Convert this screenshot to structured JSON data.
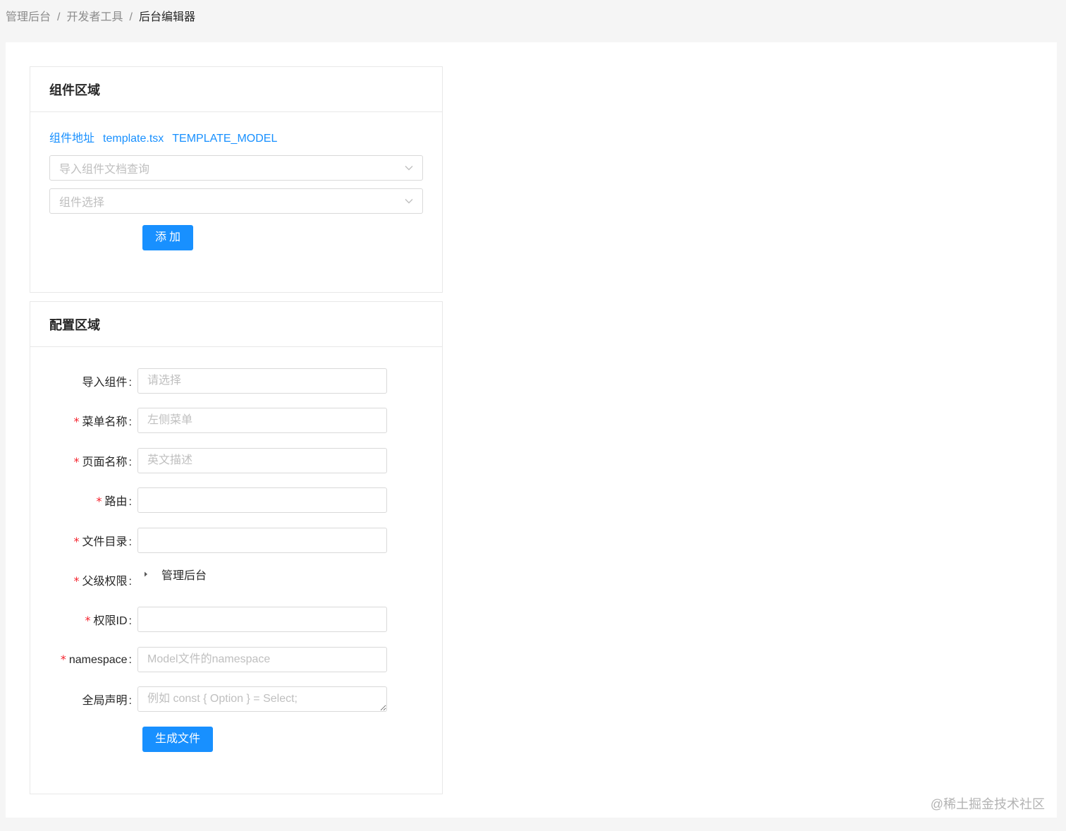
{
  "breadcrumb": {
    "items": [
      "管理后台",
      "开发者工具",
      "后台编辑器"
    ],
    "separator": "/"
  },
  "component_card": {
    "title": "组件区域",
    "links": [
      "组件地址",
      "template.tsx",
      "TEMPLATE_MODEL"
    ],
    "doc_select_placeholder": "导入组件文档查询",
    "component_select_placeholder": "组件选择",
    "add_button": "添加"
  },
  "config_card": {
    "title": "配置区域",
    "fields": {
      "import_component": {
        "label": "导入组件",
        "required": false,
        "placeholder": "请选择",
        "value": ""
      },
      "menu_name": {
        "label": "菜单名称",
        "required": true,
        "placeholder": "左侧菜单",
        "value": ""
      },
      "page_name": {
        "label": "页面名称",
        "required": true,
        "placeholder": "英文描述",
        "value": ""
      },
      "route": {
        "label": "路由",
        "required": true,
        "placeholder": "",
        "value": ""
      },
      "file_dir": {
        "label": "文件目录",
        "required": true,
        "placeholder": "",
        "value": ""
      },
      "parent_permission": {
        "label": "父级权限",
        "required": true,
        "tree_node": "管理后台"
      },
      "permission_id": {
        "label": "权限ID",
        "required": true,
        "placeholder": "",
        "value": ""
      },
      "namespace": {
        "label": "namespace",
        "required": true,
        "placeholder": "Model文件的namespace",
        "value": ""
      },
      "global_declare": {
        "label": "全局声明",
        "required": false,
        "placeholder": "例如 const { Option } = Select;",
        "value": ""
      }
    },
    "required_mark": "*",
    "colon": ":",
    "generate_button": "生成文件"
  },
  "watermark": "@稀土掘金技术社区",
  "colors": {
    "primary": "#1890ff",
    "required": "#f5222d",
    "border": "#d9d9d9",
    "background": "#f5f5f5"
  }
}
